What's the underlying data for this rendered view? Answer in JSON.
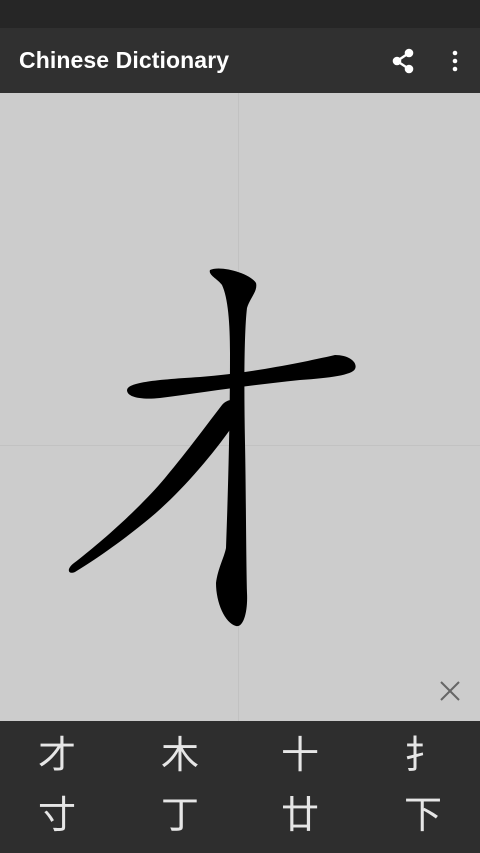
{
  "app_bar": {
    "title": "Chinese Dictionary",
    "share_icon": "share-icon",
    "overflow_icon": "more-vert-icon"
  },
  "canvas": {
    "clear_icon": "close-icon",
    "ink_color": "#000000",
    "background_color": "#cccccc"
  },
  "candidates": [
    "才",
    "木",
    "十",
    "扌",
    "寸",
    "丁",
    "廿",
    "下"
  ],
  "colors": {
    "app_bar": "#303030",
    "status_bar": "#262626",
    "candidate_bar": "#2e2e2e",
    "candidate_text": "#e6e6e6"
  }
}
